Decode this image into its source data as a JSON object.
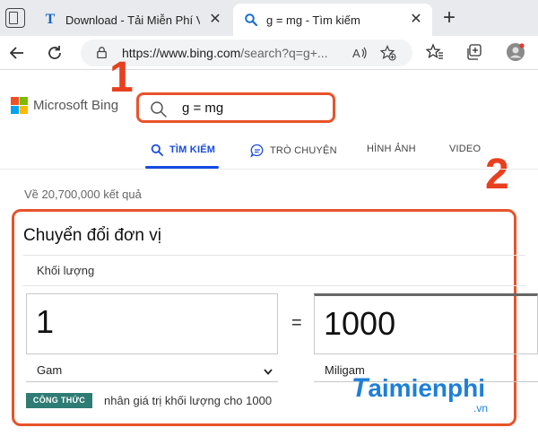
{
  "browser": {
    "tabs": [
      {
        "title": "Download - Tải Miễn Phí VN -",
        "favicon": "T"
      },
      {
        "title": "g = mg - Tìm kiếm"
      }
    ],
    "url_main": "https://www.bing.com",
    "url_rest": "/search?q=g+..."
  },
  "bing": {
    "brand": "Microsoft Bing",
    "query": "g = mg",
    "scopes": [
      {
        "label": "TÌM KIẾM"
      },
      {
        "label": "TRÒ CHUYỆN"
      },
      {
        "label": "HÌNH ẢNH"
      },
      {
        "label": "VIDEO"
      }
    ],
    "result_count": "Về 20,700,000 kết quả"
  },
  "converter": {
    "title": "Chuyển đổi đơn vị",
    "quantity": "Khối lượng",
    "from_value": "1",
    "to_value": "1000",
    "equals": "=",
    "from_unit": "Gam",
    "to_unit": "Miligam",
    "formula_label": "CÔNG THỨC",
    "formula_text": "nhân giá trị khối lượng cho 1000"
  },
  "annotations": {
    "one": "1",
    "two": "2"
  },
  "watermark": {
    "t": "T",
    "rest": "aimienphi",
    "vn": ".vn"
  },
  "colors": {
    "highlight": "#e8532b",
    "bing_blue": "#174ae4",
    "badge": "#2f7c74"
  }
}
